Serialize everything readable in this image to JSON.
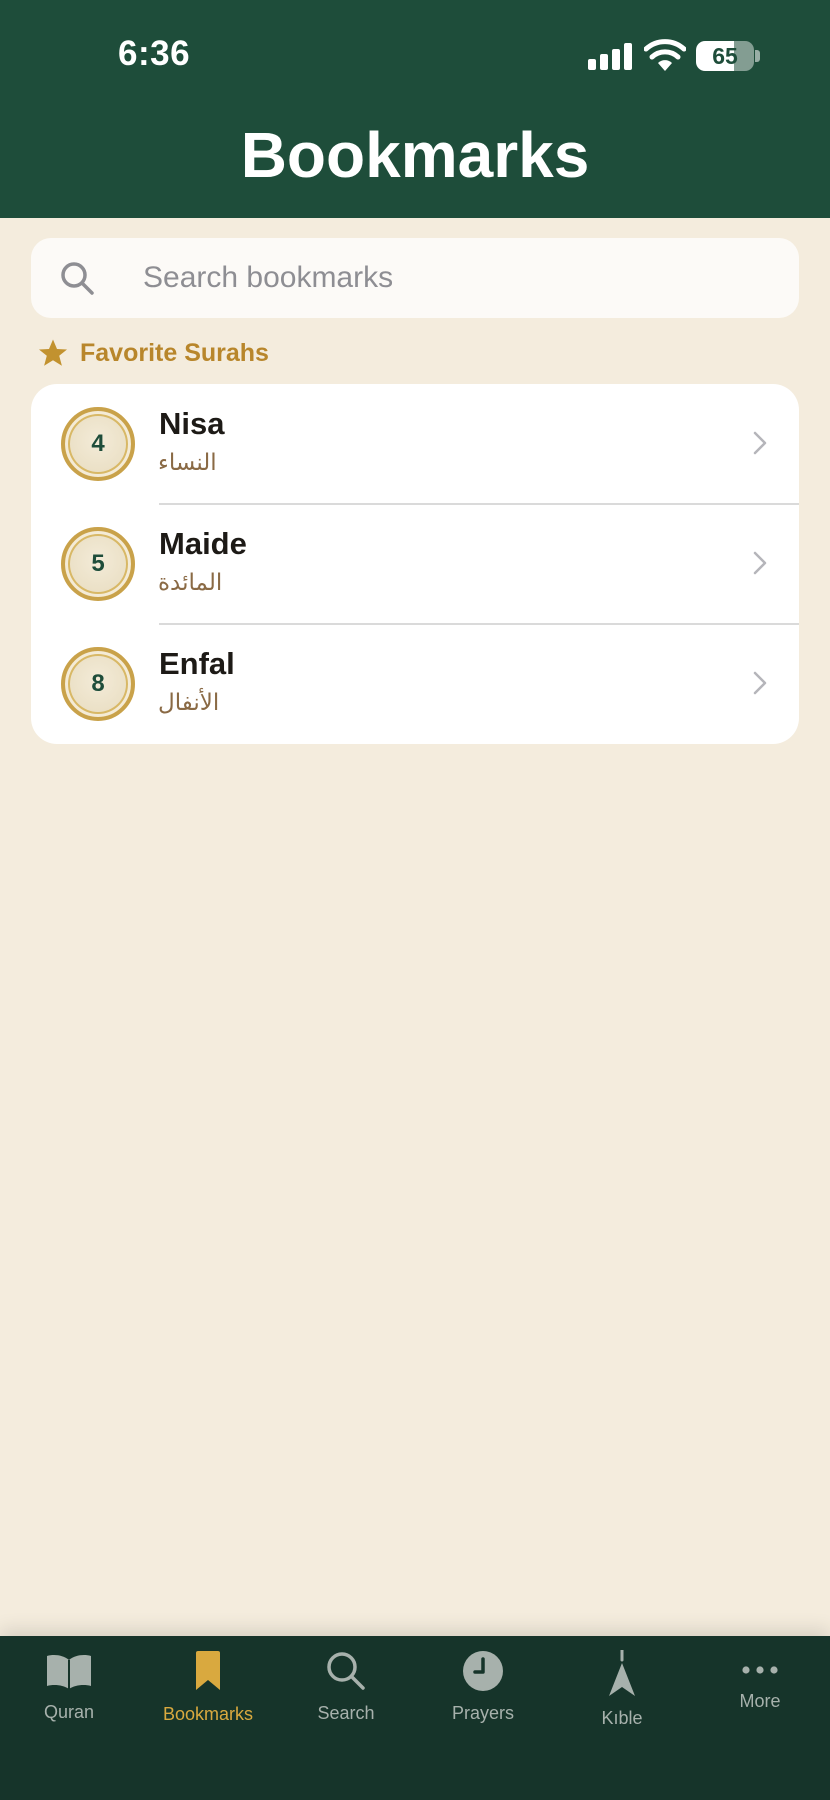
{
  "status_bar": {
    "time": "6:36",
    "battery_level": "65",
    "battery_fraction": 0.65
  },
  "header": {
    "title": "Bookmarks",
    "background_color": "#1E4D3A"
  },
  "search": {
    "placeholder": "Search bookmarks",
    "value": ""
  },
  "favorites_section": {
    "icon": "star-icon",
    "title": "Favorite Surahs",
    "accent_color": "#B8862B"
  },
  "favorites": [
    {
      "number": "4",
      "name": "Nisa",
      "arabic": "النساء"
    },
    {
      "number": "5",
      "name": "Maide",
      "arabic": "المائدة"
    },
    {
      "number": "8",
      "name": "Enfal",
      "arabic": "الأنفال"
    }
  ],
  "tab_bar": {
    "tabs": [
      {
        "label": "Quran",
        "icon": "open-book-icon",
        "active": false
      },
      {
        "label": "Bookmarks",
        "icon": "bookmark-icon",
        "active": true
      },
      {
        "label": "Search",
        "icon": "magnifier-icon",
        "active": false
      },
      {
        "label": "Prayers",
        "icon": "clock-icon",
        "active": false
      },
      {
        "label": "Kıble",
        "icon": "compass-arrow-icon",
        "active": false
      },
      {
        "label": "More",
        "icon": "ellipsis-icon",
        "active": false
      }
    ],
    "active_color": "#D9A93F",
    "inactive_color": "#A7B1AC"
  }
}
